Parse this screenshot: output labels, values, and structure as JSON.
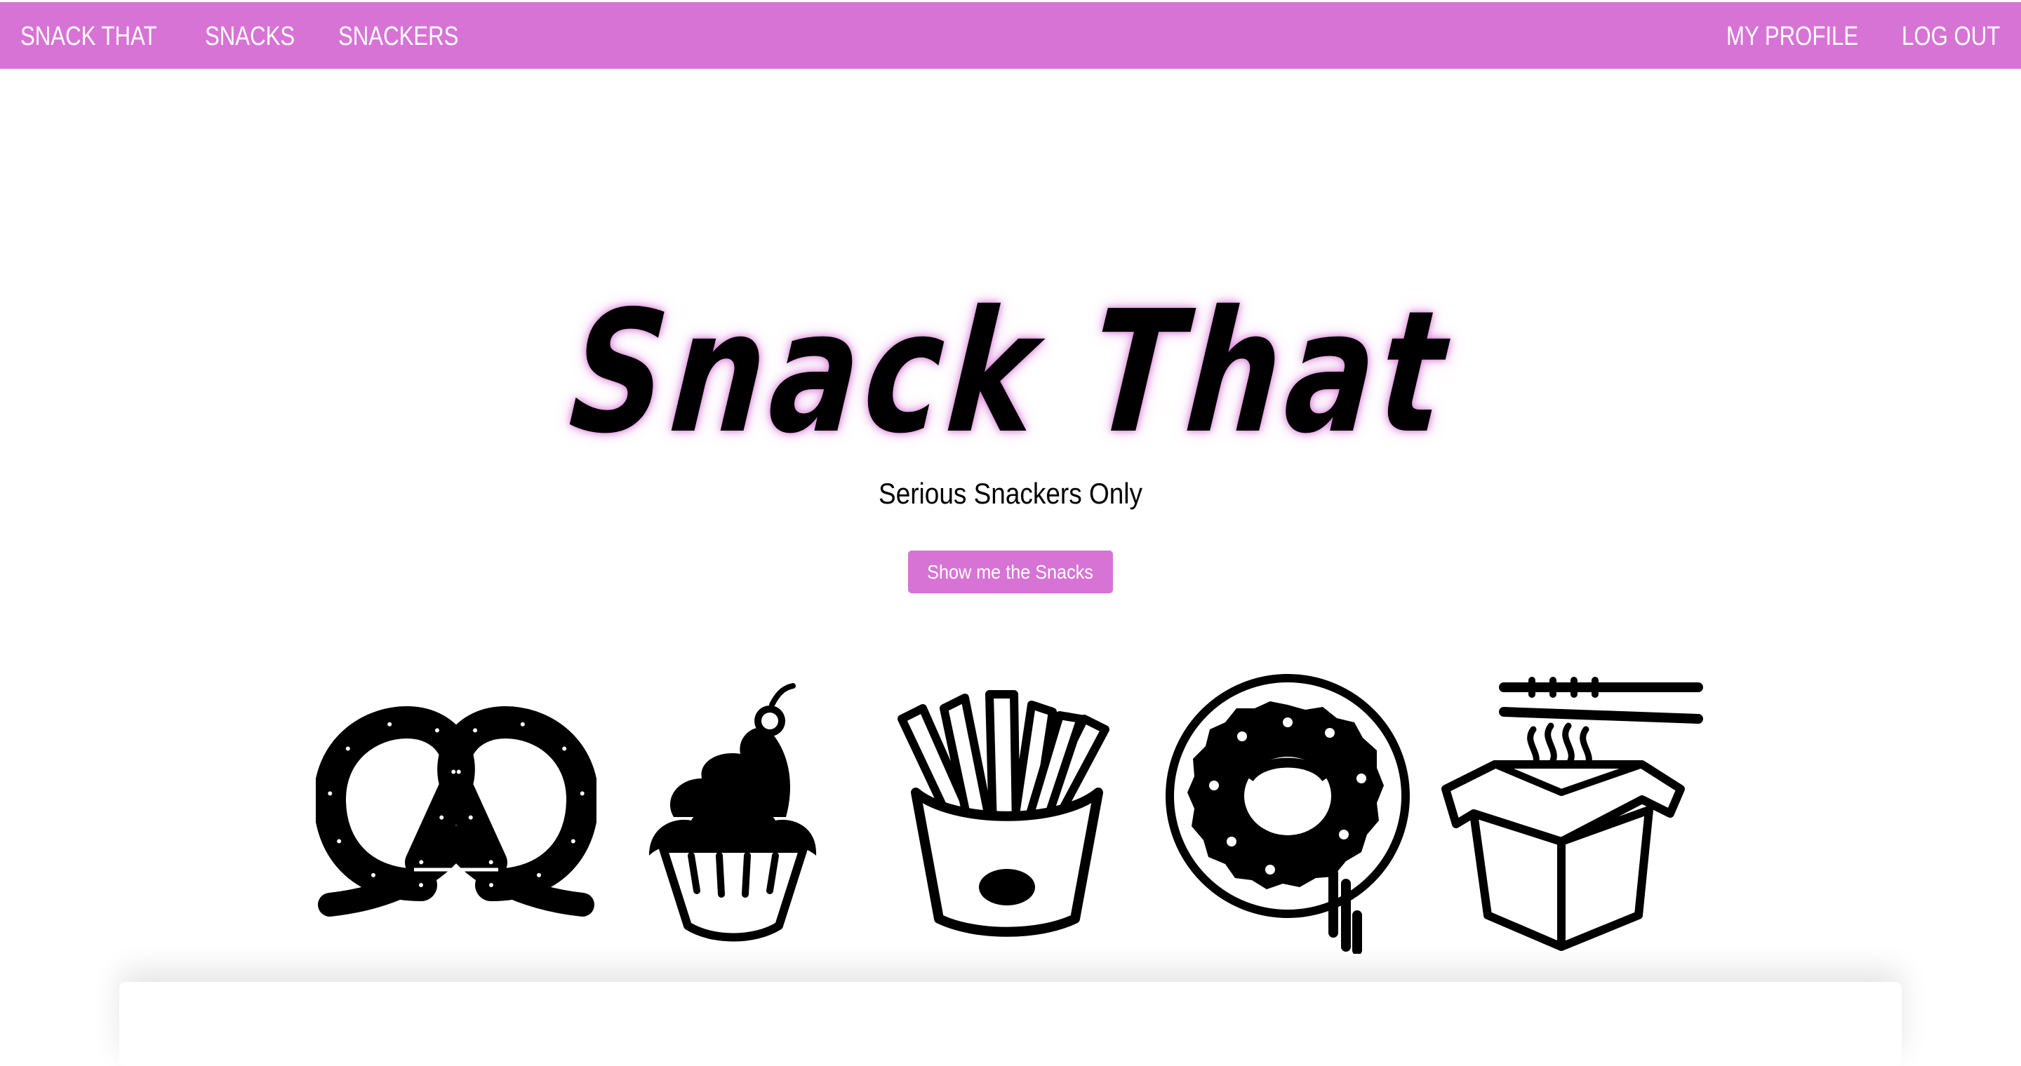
{
  "nav": {
    "brand": "SNACK THAT",
    "snacks": "SNACKS",
    "snackers": "SNACKERS",
    "my_profile": "MY PROFILE",
    "log_out": "LOG OUT"
  },
  "hero": {
    "title": "Snack That",
    "tagline": "Serious Snackers Only",
    "cta_label": "Show me the Snacks"
  },
  "icons": [
    "pretzel-icon",
    "cupcake-icon",
    "fries-icon",
    "donut-icon",
    "noodle-box-icon"
  ],
  "colors": {
    "accent": "#d873d6",
    "text": "#000000",
    "background": "#ffffff"
  }
}
